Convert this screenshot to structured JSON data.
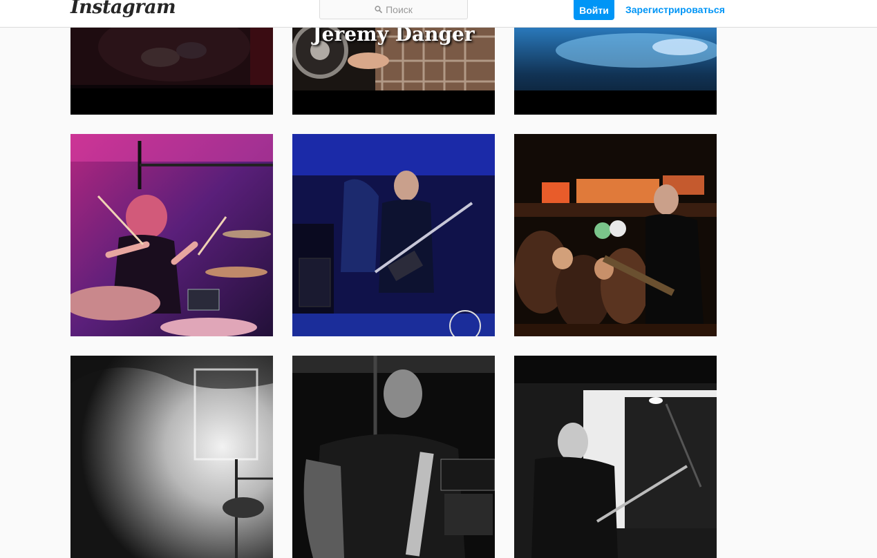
{
  "header": {
    "logo_text": "Instagram",
    "search": {
      "placeholder": "Поиск",
      "icon": "search-icon"
    },
    "login_button": "Войти",
    "signup_link": "Зарегистрироваться"
  },
  "grid": {
    "post_captions": {
      "jeremy": "Jeremy Danger"
    }
  },
  "colors": {
    "accent": "#0095f6",
    "page_bg": "#fafafa",
    "border": "#dbdbdb"
  }
}
